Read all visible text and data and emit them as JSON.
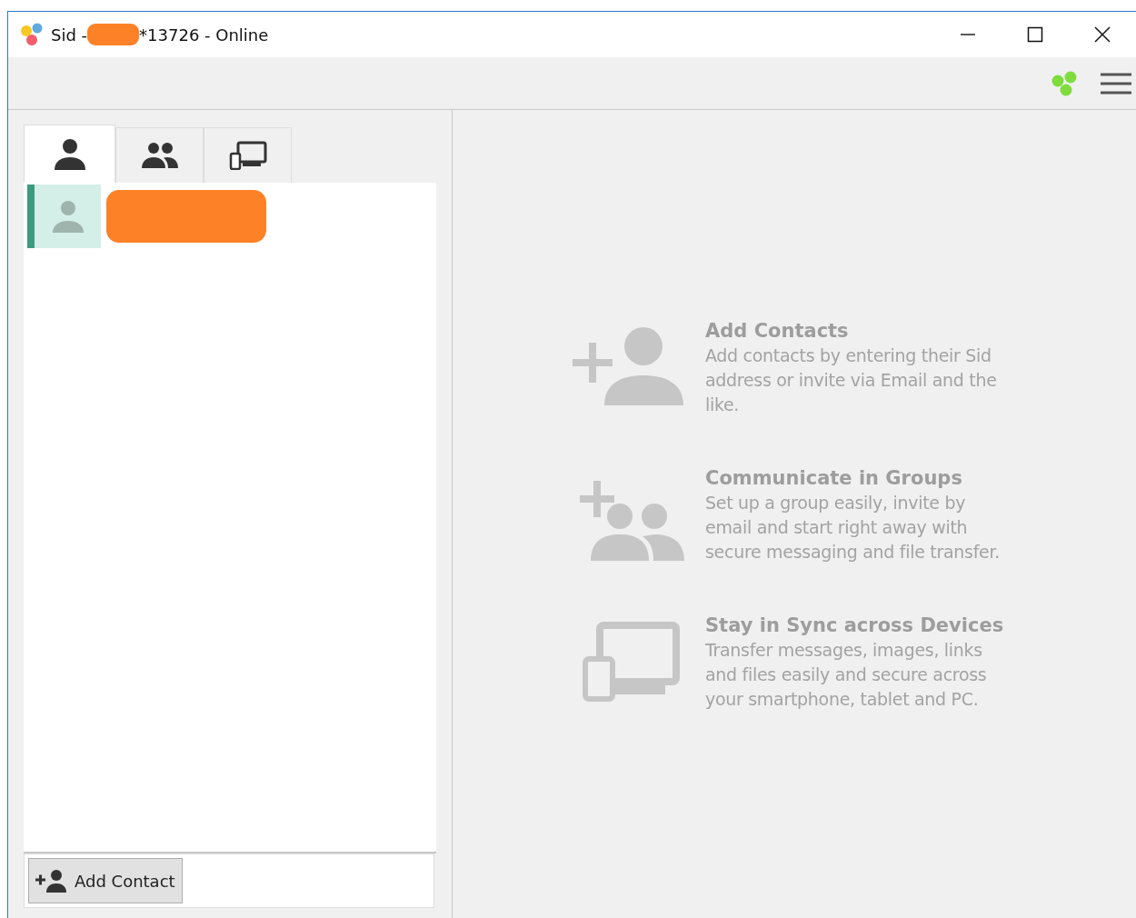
{
  "window": {
    "title_prefix": "Sid -",
    "title_suffix": "*13726 - Online"
  },
  "tabs": [
    {
      "kind": "contacts",
      "selected": true
    },
    {
      "kind": "groups",
      "selected": false
    },
    {
      "kind": "devices",
      "selected": false
    }
  ],
  "contacts": [
    {
      "selected": true
    }
  ],
  "add_button": "Add Contact",
  "features": [
    {
      "kind": "contacts",
      "title": "Add Contacts",
      "text": "Add contacts by entering their Sid address or invite via Email and the like."
    },
    {
      "kind": "groups",
      "title": "Communicate in Groups",
      "text": "Set up a group easily, invite by email and start right away with secure messaging and file transfer."
    },
    {
      "kind": "devices",
      "title": "Stay in Sync across Devices",
      "text": "Transfer messages, images, links and files easily and secure across your smartphone, tablet and PC."
    }
  ]
}
